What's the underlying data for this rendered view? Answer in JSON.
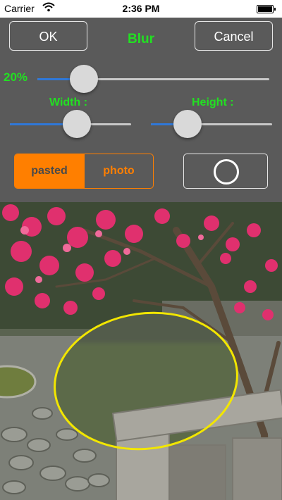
{
  "status_bar": {
    "carrier": "Carrier",
    "time": "2:36 PM"
  },
  "toolbar": {
    "ok_label": "OK",
    "title": "Blur",
    "cancel_label": "Cancel"
  },
  "blur": {
    "percent_label": "20%",
    "level": 0.2
  },
  "size": {
    "width_label": "Width :",
    "width_level": 0.55,
    "height_label": "Height :",
    "height_level": 0.3
  },
  "mode": {
    "options": [
      "pasted",
      "photo"
    ],
    "selected": "pasted"
  },
  "shape": {
    "icon": "circle-icon"
  },
  "colors": {
    "accent_green": "#22e022",
    "accent_orange": "#ff7f00",
    "slider_blue": "#2f78d8",
    "blur_outline": "#f2e600",
    "panel_bg": "#5a5a5a"
  }
}
